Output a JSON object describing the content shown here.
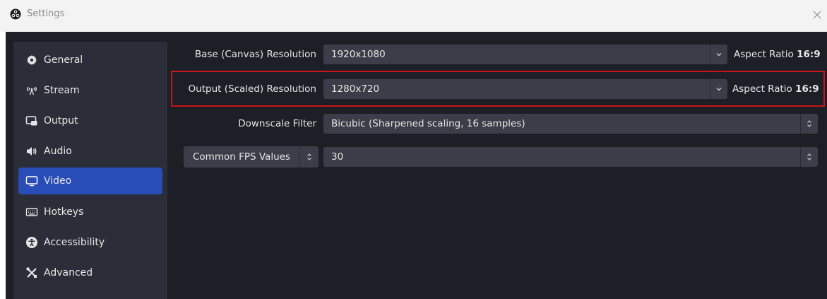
{
  "window": {
    "title": "Settings",
    "close_glyph": "×"
  },
  "sidebar": {
    "items": [
      {
        "label": "General",
        "icon": "gear-icon"
      },
      {
        "label": "Stream",
        "icon": "broadcast-icon"
      },
      {
        "label": "Output",
        "icon": "output-icon"
      },
      {
        "label": "Audio",
        "icon": "speaker-icon"
      },
      {
        "label": "Video",
        "icon": "monitor-icon",
        "active": true
      },
      {
        "label": "Hotkeys",
        "icon": "keyboard-icon"
      },
      {
        "label": "Accessibility",
        "icon": "accessibility-icon"
      },
      {
        "label": "Advanced",
        "icon": "tools-icon"
      }
    ]
  },
  "video": {
    "base_label": "Base (Canvas) Resolution",
    "base_value": "1920x1080",
    "base_aspect_prefix": "Aspect Ratio",
    "base_aspect_value": "16:9",
    "output_label": "Output (Scaled) Resolution",
    "output_value": "1280x720",
    "output_aspect_prefix": "Aspect Ratio",
    "output_aspect_value": "16:9",
    "downscale_label": "Downscale Filter",
    "downscale_value": "Bicubic (Sharpened scaling, 16 samples)",
    "fps_type": "Common FPS Values",
    "fps_value": "30"
  },
  "colors": {
    "accent": "#284cb8",
    "highlight": "#c8141a",
    "sidebar_bg": "#2b2e38",
    "field_bg": "#3b3e48"
  }
}
